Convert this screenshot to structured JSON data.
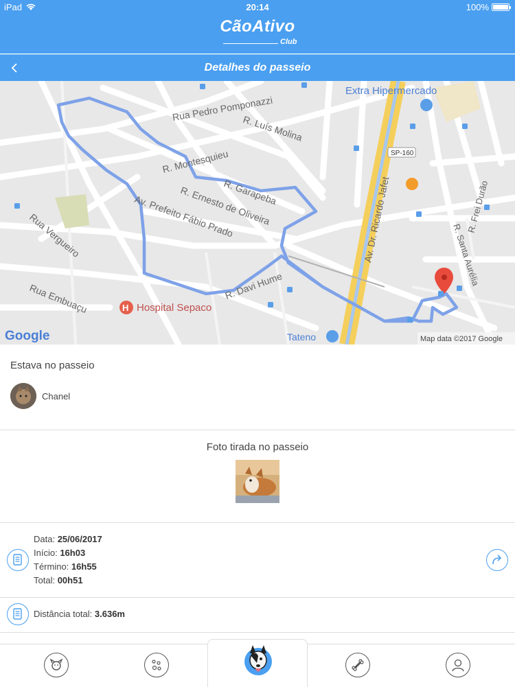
{
  "status_bar": {
    "carrier": "iPad",
    "time": "20:14",
    "battery": "100%",
    "battery_level": 1.0
  },
  "app": {
    "brand": "CãoAtivo",
    "brand_sub": "Club",
    "accent_color": "#4a9ff0"
  },
  "nav": {
    "title": "Detalhes do passeio",
    "back_icon": "chevron-left-icon"
  },
  "map": {
    "labels": {
      "rua_pedro": "Rua Pedro Pomponazzi",
      "luis_molina": "R. Luís Molina",
      "montesquieu": "R. Montesquieu",
      "garapeba": "R. Garapeba",
      "ernesto": "R. Ernesto de Oliveira",
      "fabio_prado": "Av. Prefeito Fábio Prado",
      "vergueiro": "Rua Vergueiro",
      "embuacu": "Rua Embuaçu",
      "davi_hume": "R. Davi Hume",
      "ricardo_jafet": "Av. Dr. Ricardo Jafet",
      "sp160": "SP-160",
      "frei_durao": "R. Frei Durão",
      "santa_aurelia": "R. Santa Aurélia",
      "extra": "Extra Hipermercado",
      "hospital": "Hospital Sepaco",
      "tateno": "Tateno",
      "google": "Google",
      "attribution": "Map data ©2017 Google"
    }
  },
  "walk": {
    "heading": "Estava no passeio",
    "pet_name": "Chanel"
  },
  "photo": {
    "heading": "Foto tirada no passeio"
  },
  "details": {
    "data_label": "Data:",
    "data_value": "25/06/2017",
    "inicio_label": "Início:",
    "inicio_value": "16h03",
    "termino_label": "Término:",
    "termino_value": "16h55",
    "total_label": "Total:",
    "total_value": "00h51"
  },
  "distance": {
    "label": "Distância total:",
    "value": "3.636m"
  },
  "tabs": [
    {
      "icon": "dog-face-icon"
    },
    {
      "icon": "paw-prints-icon"
    },
    {
      "icon": "dog-mascot-icon"
    },
    {
      "icon": "bone-icon"
    },
    {
      "icon": "user-profile-icon"
    }
  ]
}
